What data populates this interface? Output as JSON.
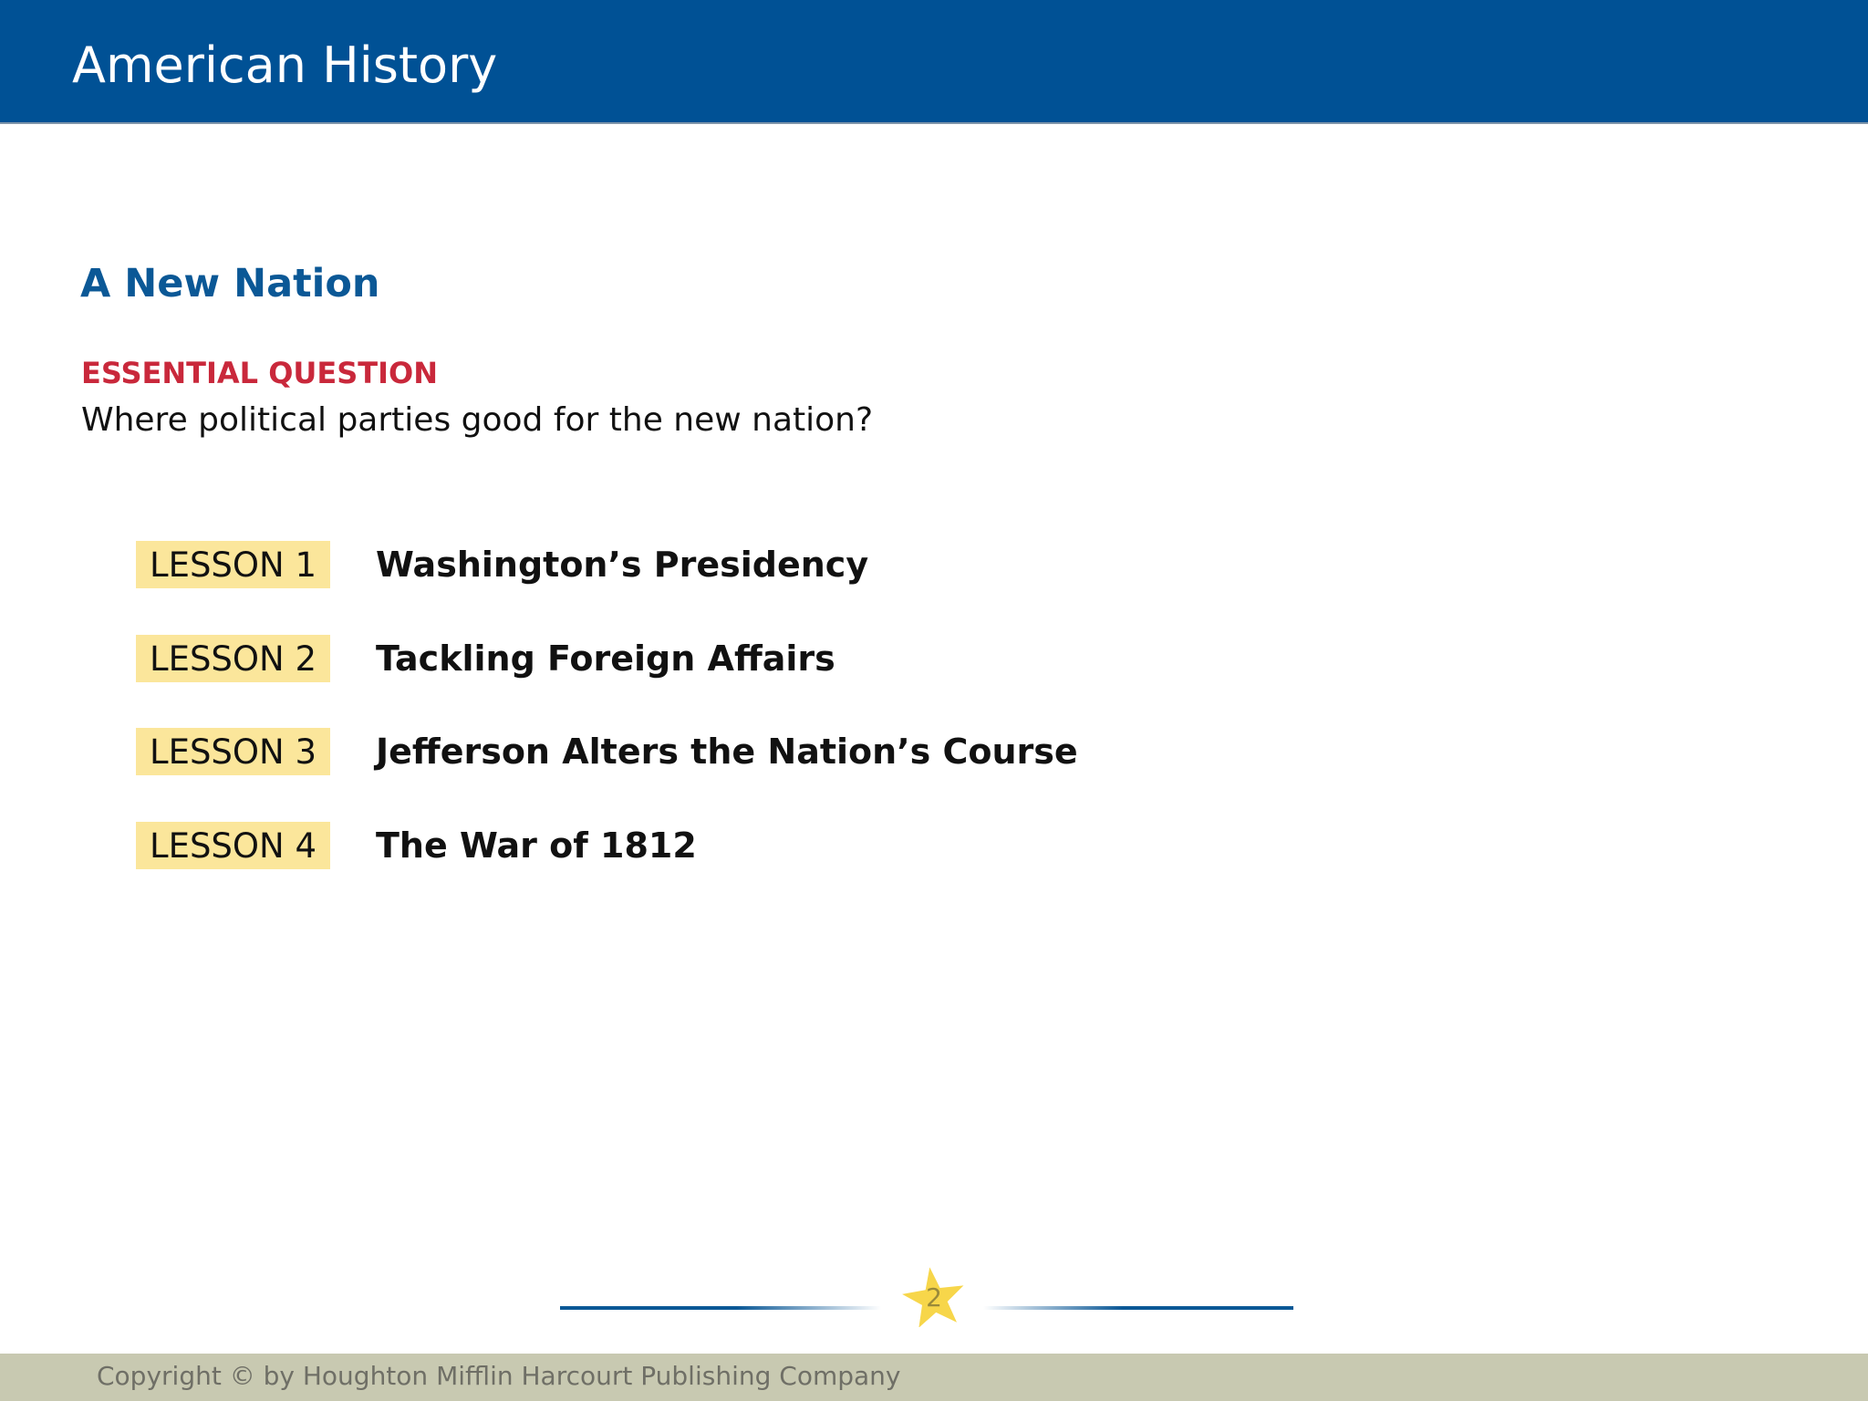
{
  "header": {
    "title": "American History",
    "background_color": "#005195"
  },
  "chapter": {
    "title": "A New Nation",
    "color": "#0b5896"
  },
  "essential_question": {
    "label": "ESSENTIAL QUESTION",
    "label_color": "#c9283b",
    "text": "Where political parties good for the new nation?"
  },
  "lessons": [
    {
      "badge": "LESSON 1",
      "title": "Washington’s Presidency"
    },
    {
      "badge": "LESSON 2",
      "title": "Tackling Foreign Affairs"
    },
    {
      "badge": "LESSON 3",
      "title": "Jefferson Alters the Nation’s Course"
    },
    {
      "badge": "LESSON 4",
      "title": "The War of 1812"
    }
  ],
  "lesson_badge_color": "#fbe69b",
  "page": {
    "number": "2",
    "divider_icon": "star-icon",
    "star_color": "#f7d64a",
    "line_color": "#0b5896"
  },
  "footer": {
    "copyright": "Copyright © by Houghton Mifflin Harcourt Publishing Company",
    "background_color": "#c8c9b1"
  }
}
